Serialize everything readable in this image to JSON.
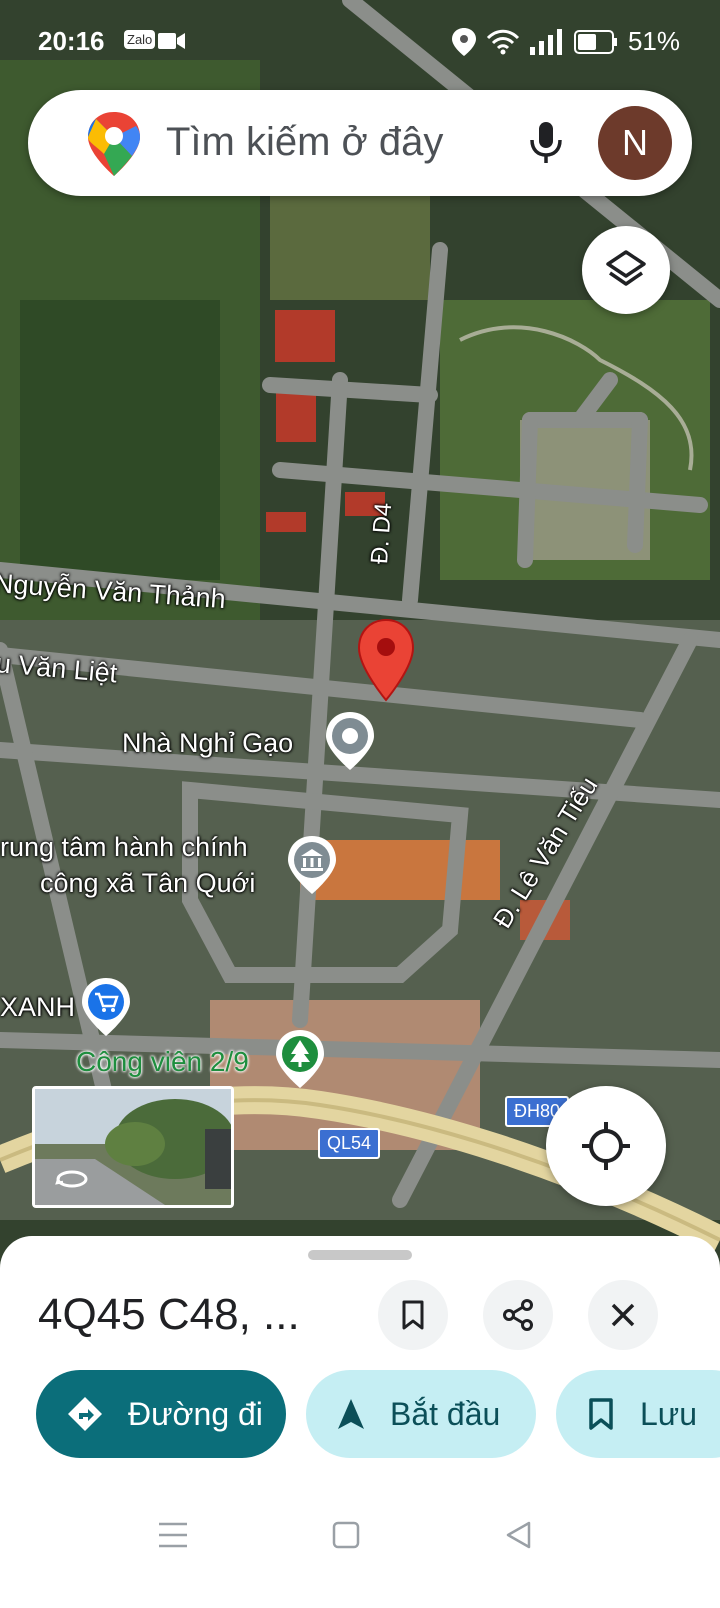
{
  "status_bar": {
    "time": "20:16",
    "battery": "51%",
    "app_badge": "Zalo"
  },
  "search": {
    "placeholder": "Tìm kiếm ở đây",
    "avatar_letter": "N"
  },
  "map_labels": {
    "street_nguyen_van_thanh": "Nguyễn Văn Thảnh",
    "street_huynh_van_liet": "u Văn Liệt",
    "street_d4": "Đ. D4",
    "street_le_van_tieu": "Đ. Lê Văn Tiếu",
    "poi_nha_nghi": "Nhà Nghỉ Gạo",
    "poi_trung_tam_line1": "rung tâm hành chính",
    "poi_trung_tam_line2": "công xã Tân Quới",
    "poi_shop": "XANH",
    "poi_park": "Công viên 2/9",
    "road_ql54": "QL54",
    "road_dh80": "ĐH80"
  },
  "place_sheet": {
    "title": "4Q45 C48, ...",
    "buttons": {
      "directions": "Đường đi",
      "start": "Bắt đầu",
      "save": "Lưu"
    }
  },
  "colors": {
    "primary": "#0b6e7a",
    "chip_light": "#c5eef3",
    "pin": "#ea4335"
  }
}
